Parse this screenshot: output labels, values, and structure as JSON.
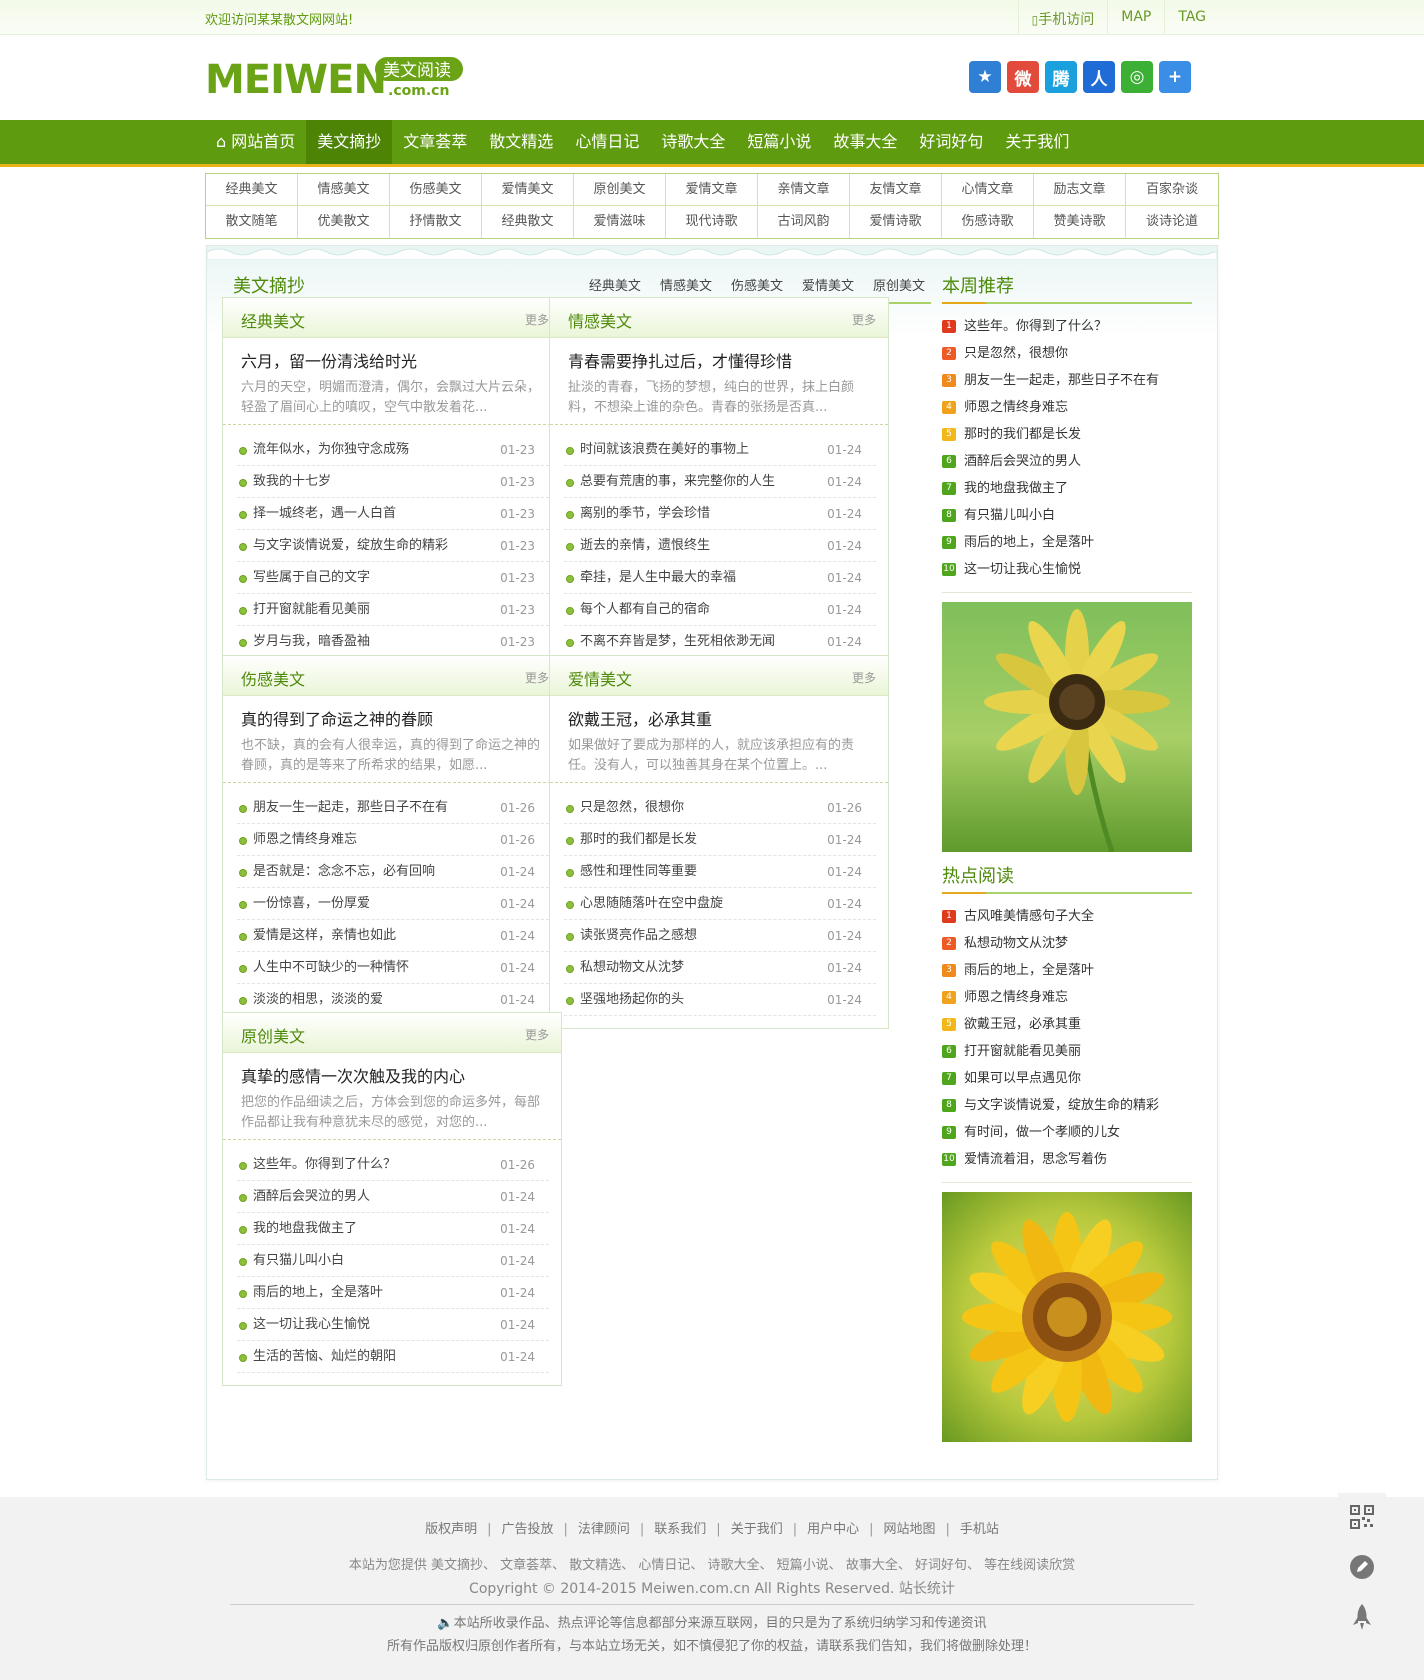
{
  "topbar": {
    "welcome": "欢迎访问某某散文网网站!",
    "mobile": "手机访问",
    "map": "MAP",
    "tag": "TAG"
  },
  "logo": {
    "text": "MEIWEN",
    "badge": "美文阅读",
    "domain": ".com.cn"
  },
  "nav": [
    "网站首页",
    "美文摘抄",
    "文章荟萃",
    "散文精选",
    "心情日记",
    "诗歌大全",
    "短篇小说",
    "故事大全",
    "好词好句",
    "关于我们"
  ],
  "subnav": [
    "经典美文",
    "情感美文",
    "伤感美文",
    "爱情美文",
    "原创美文",
    "爱情文章",
    "亲情文章",
    "友情文章",
    "心情文章",
    "励志文章",
    "百家杂谈",
    "散文随笔",
    "优美散文",
    "抒情散文",
    "经典散文",
    "爱情滋味",
    "现代诗歌",
    "古词风韵",
    "爱情诗歌",
    "伤感诗歌",
    "赞美诗歌",
    "谈诗论道"
  ],
  "section": {
    "title": "美文摘抄",
    "tabs": [
      "经典美文",
      "情感美文",
      "伤感美文",
      "爱情美文",
      "原创美文"
    ]
  },
  "more": "更多",
  "boxes": [
    {
      "title": "经典美文",
      "ftitle": "六月，留一份清浅给时光",
      "fsum": "六月的天空，明媚而澄清，偶尔，会飘过大片云朵，轻盈了眉间心上的嗔叹，空气中散发着花...",
      "items": [
        [
          "流年似水，为你独守念成殇",
          "01-23"
        ],
        [
          "致我的十七岁",
          "01-23"
        ],
        [
          "择一城终老，遇一人白首",
          "01-23"
        ],
        [
          "与文字谈情说爱，绽放生命的精彩",
          "01-23"
        ],
        [
          "写些属于自己的文字",
          "01-23"
        ],
        [
          "打开窗就能看见美丽",
          "01-23"
        ],
        [
          "岁月与我，暗香盈袖",
          "01-23"
        ]
      ]
    },
    {
      "title": "情感美文",
      "ftitle": "青春需要挣扎过后，才懂得珍惜",
      "fsum": "扯淡的青春，飞扬的梦想，纯白的世界，抹上白颜料，不想染上谁的杂色。青春的张扬是否真...",
      "items": [
        [
          "时间就该浪费在美好的事物上",
          "01-24"
        ],
        [
          "总要有荒唐的事，来完整你的人生",
          "01-24"
        ],
        [
          "离别的季节，学会珍惜",
          "01-24"
        ],
        [
          "逝去的亲情，遗恨终生",
          "01-24"
        ],
        [
          "牵挂，是人生中最大的幸福",
          "01-24"
        ],
        [
          "每个人都有自己的宿命",
          "01-24"
        ],
        [
          "不离不弃皆是梦，生死相依渺无闻",
          "01-24"
        ]
      ]
    },
    {
      "title": "伤感美文",
      "ftitle": "真的得到了命运之神的眷顾",
      "fsum": "也不缺，真的会有人很幸运，真的得到了命运之神的眷顾，真的是等来了所希求的结果，如愿...",
      "items": [
        [
          "朋友一生一起走，那些日子不在有",
          "01-26"
        ],
        [
          "师恩之情终身难忘",
          "01-26"
        ],
        [
          "是否就是：念念不忘，必有回响",
          "01-24"
        ],
        [
          "一份惊喜，一份厚爱",
          "01-24"
        ],
        [
          "爱情是这样，亲情也如此",
          "01-24"
        ],
        [
          "人生中不可缺少的一种情怀",
          "01-24"
        ],
        [
          "淡淡的相思，淡淡的爱",
          "01-24"
        ]
      ]
    },
    {
      "title": "爱情美文",
      "ftitle": "欲戴王冠，必承其重",
      "fsum": "如果做好了要成为那样的人，就应该承担应有的责任。没有人，可以独善其身在某个位置上。...",
      "items": [
        [
          "只是忽然，很想你",
          "01-26"
        ],
        [
          "那时的我们都是长发",
          "01-24"
        ],
        [
          "感性和理性同等重要",
          "01-24"
        ],
        [
          "心思随随落叶在空中盘旋",
          "01-24"
        ],
        [
          "读张贤亮作品之感想",
          "01-24"
        ],
        [
          "私想动物文从沈梦",
          "01-24"
        ],
        [
          "坚强地扬起你的头",
          "01-24"
        ]
      ]
    },
    {
      "title": "原创美文",
      "ftitle": "真挚的感情一次次触及我的内心",
      "fsum": "把您的作品细读之后，方体会到您的命运多舛，每部作品都让我有种意犹未尽的感觉，对您的...",
      "items": [
        [
          "这些年。你得到了什么？",
          "01-26"
        ],
        [
          "酒醉后会哭泣的男人",
          "01-24"
        ],
        [
          "我的地盘我做主了",
          "01-24"
        ],
        [
          "有只猫儿叫小白",
          "01-24"
        ],
        [
          "雨后的地上，全是落叶",
          "01-24"
        ],
        [
          "这一切让我心生愉悦",
          "01-24"
        ],
        [
          "生活的苦恼、灿烂的朝阳",
          "01-24"
        ]
      ]
    }
  ],
  "weekly": {
    "title": "本周推荐",
    "items": [
      "这些年。你得到了什么？",
      "只是忽然，很想你",
      "朋友一生一起走，那些日子不在有",
      "师恩之情终身难忘",
      "那时的我们都是长发",
      "酒醉后会哭泣的男人",
      "我的地盘我做主了",
      "有只猫儿叫小白",
      "雨后的地上，全是落叶",
      "这一切让我心生愉悦"
    ]
  },
  "hot": {
    "title": "热点阅读",
    "items": [
      "古风唯美情感句子大全",
      "私想动物文从沈梦",
      "雨后的地上，全是落叶",
      "师恩之情终身难忘",
      "欲戴王冠，必承其重",
      "打开窗就能看见美丽",
      "如果可以早点遇见你",
      "与文字谈情说爱，绽放生命的精彩",
      "有时间，做一个孝顺的儿女",
      "爱情流着泪，思念写着伤"
    ]
  },
  "rank_colors": [
    "#e03a1e",
    "#ee5a24",
    "#f08a1c",
    "#f0a21c",
    "#f2b81a",
    "#4fa61c",
    "#4fa61c",
    "#4fa61c",
    "#4fa61c",
    "#4fa61c"
  ],
  "footer": {
    "links": [
      "版权声明",
      "广告投放",
      "法律顾问",
      "联系我们",
      "关于我们",
      "用户中心",
      "网站地图",
      "手机站"
    ],
    "service": "本站为您提供 美文摘抄、 文章荟萃、 散文精选、 心情日记、 诗歌大全、 短篇小说、 故事大全、 好词好句、 等在线阅读欣赏",
    "copyright": "Copyright © 2014-2015 Meiwen.com.cn All Rights Reserved. 站长统计",
    "note1": "本站所收录作品、热点评论等信息都部分来源互联网，目的只是为了系统归纳学习和传递资讯",
    "note2": "所有作品版权归原创作者所有，与本站立场无关，如不慎侵犯了你的权益，请联系我们告知，我们将做删除处理！"
  }
}
